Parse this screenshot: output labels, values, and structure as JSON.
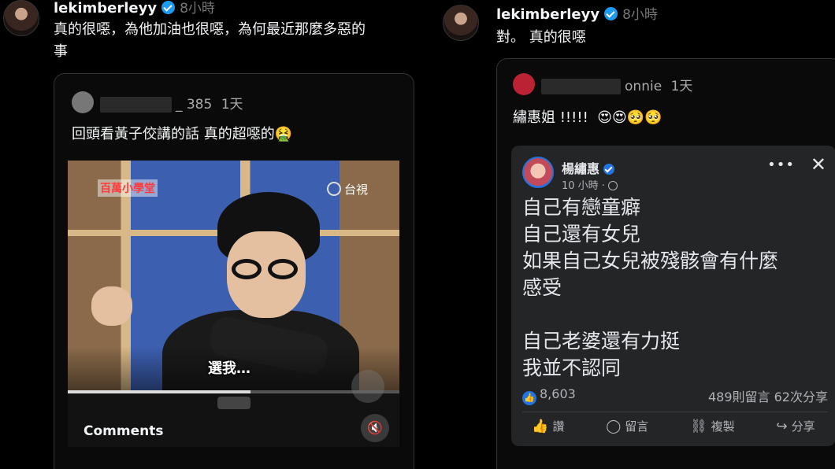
{
  "left_post": {
    "username": "lekimberleyy",
    "time": "8小時",
    "text_line1": "真的很噁，為他加油也很噁，為何最近那麼多惡的",
    "text_line2": "事",
    "quote": {
      "handle_visible": "_ 385",
      "time": "1天",
      "text": "回頭看黃子佼講的話 真的超噁的🤮",
      "video": {
        "logo_left": "百萬小學堂",
        "logo_right": "台視",
        "subtitle": "選我…",
        "progress": 0.55
      },
      "comments_label": "Comments",
      "mute_icon": "🔇"
    }
  },
  "right_post": {
    "username": "lekimberleyy",
    "time": "8小時",
    "text": "對。 真的很噁",
    "quote": {
      "handle_visible": "onnie",
      "time": "1天",
      "text": "繡惠姐 !!!!!  😍😍🥺🥺",
      "fb": {
        "name": "楊繡惠",
        "time": "10 小時 ·",
        "more": "•••",
        "close": "✕",
        "body": [
          "自己有戀童癖",
          "自己還有女兒",
          "如果自己女兒被殘骸會有什麼",
          "感受",
          "",
          "自己老婆還有力挺",
          "我並不認同"
        ],
        "likes": "8,603",
        "comments_shares": "489則留言  62次分享",
        "actions": {
          "like": "讚",
          "comment": "留言",
          "copy": "複製",
          "share": "分享"
        },
        "icons": {
          "like": "👍",
          "comment": "◯",
          "copy": "⛓",
          "share": "↪"
        }
      }
    }
  }
}
